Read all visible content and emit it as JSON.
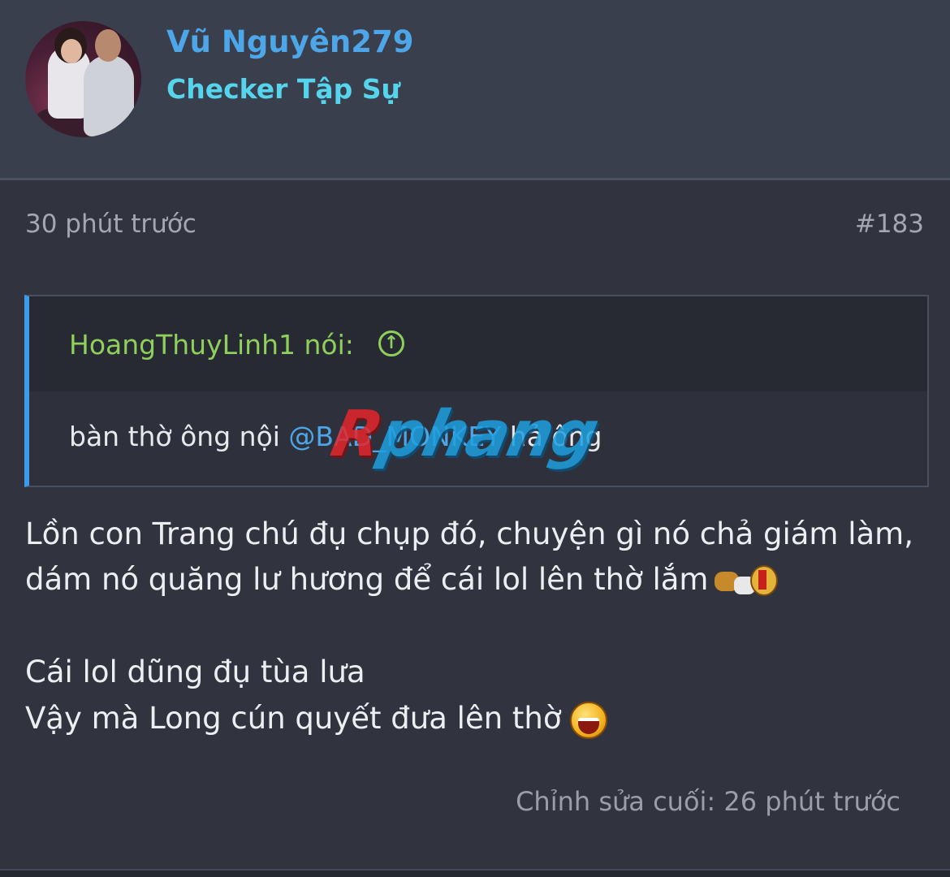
{
  "author": {
    "name": "Vũ Nguyên279",
    "title": "Checker Tập Sự"
  },
  "post": {
    "time": "30 phút trước",
    "number": "#183",
    "quote": {
      "author_label": "HoangThuyLinh1 nói:",
      "text_before": "bàn thờ ông nội ",
      "mention": "@BAD_MONKEY",
      "text_after": " hả ông"
    },
    "lines": [
      "Lồn con Trang chú đụ chụp đó, chuyện gì nó chả giám làm,",
      "dám nó quăng lư hương để cái lol lên thờ lắm",
      "Cái lol dũng đụ tùa lưa",
      "Vậy mà Long cún quyết đưa lên thờ"
    ],
    "edited": "Chỉnh sửa cuối: 26 phút trước"
  },
  "watermark": {
    "text_red": "R",
    "text_blue": "phang"
  },
  "colors": {
    "background": "#31343f",
    "header": "#3a3f4e",
    "username": "#4da6e8",
    "usertitle": "#55d4ec",
    "quote_author": "#8fcf5c",
    "quote_border": "#3d9be9"
  }
}
